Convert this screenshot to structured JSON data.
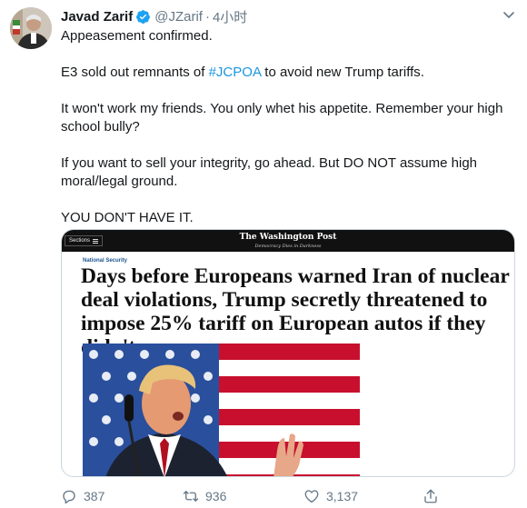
{
  "tweet": {
    "author_name": "Javad Zarif",
    "handle": "@JZarif",
    "separator": "·",
    "time": "4小时",
    "text_lines": {
      "line1": "Appeasement confirmed.",
      "line2_pre": "E3 sold out remnants of ",
      "line2_hashtag": "#JCPOA",
      "line2_post": " to avoid new Trump tariffs.",
      "line3": "It won't work my friends. You only whet his appetite. Remember your high school bully?",
      "line4": "If you want to sell your integrity, go ahead. But DO NOT assume high moral/legal ground.",
      "line5": "YOU DON'T HAVE IT."
    }
  },
  "card": {
    "sections_label": "Sections",
    "masthead": "The Washington Post",
    "tagline": "Democracy Dies in Darkness",
    "section": "National Security",
    "headline": "Days before Europeans warned Iran of nuclear deal violations, Trump secretly threatened to impose 25% tariff on European autos if they didn't"
  },
  "actions": {
    "replies": "387",
    "retweets": "936",
    "likes": "3,137"
  },
  "colors": {
    "link": "#1b95e0",
    "verified": "#1da1f2",
    "muted": "#657786",
    "border": "#ccd6dd"
  },
  "icons": [
    "verified-badge-icon",
    "chevron-down-icon",
    "reply-icon",
    "retweet-icon",
    "like-icon",
    "share-icon"
  ]
}
